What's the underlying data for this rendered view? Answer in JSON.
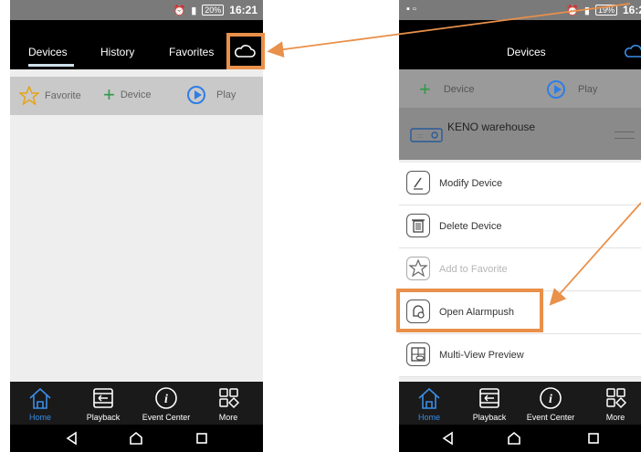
{
  "left_phone": {
    "status": {
      "battery": "20%",
      "time": "16:21"
    },
    "tabs": [
      "Devices",
      "History",
      "Favorites"
    ],
    "toolbar": {
      "favorite": "Favorite",
      "device": "Device",
      "play": "Play"
    },
    "bottom": [
      "Home",
      "Playback",
      "Event Center",
      "More"
    ]
  },
  "right_phone": {
    "status": {
      "battery": "19%",
      "time": "16:2"
    },
    "title": "Devices",
    "toolbar": {
      "device": "Device",
      "play": "Play"
    },
    "device_name": "KENO warehouse",
    "menu": [
      {
        "label": "Modify Device"
      },
      {
        "label": "Delete Device"
      },
      {
        "label": "Add to Favorite"
      },
      {
        "label": "Open Alarmpush"
      },
      {
        "label": "Multi-View Preview"
      }
    ],
    "bottom": [
      "Home",
      "Playback",
      "Event Center",
      "More"
    ]
  },
  "colors": {
    "accent": "#e9904a",
    "active": "#3a8ee6",
    "add": "#2f9a47"
  }
}
